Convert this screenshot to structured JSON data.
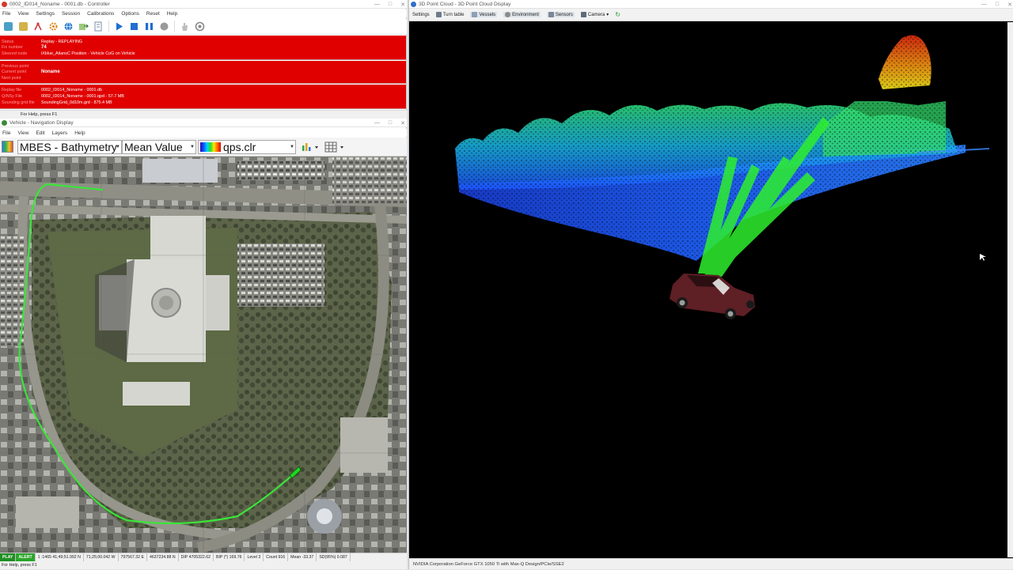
{
  "controller": {
    "title": "0002_ID014_Noname - 0001.db - Controller",
    "menu": [
      "File",
      "View",
      "Settings",
      "Session",
      "Calibrations",
      "Options",
      "Reset",
      "Help"
    ],
    "toolbar_icons": [
      "vehicle-icon",
      "database-icon",
      "calibration-icon",
      "settings-icon",
      "globe-icon",
      "export-icon",
      "document-icon",
      "play-icon",
      "stop-icon",
      "pause-icon",
      "record-icon",
      "hand-icon",
      "reset-icon"
    ],
    "panel1": {
      "rows": [
        {
          "key": "Status",
          "value": "Replay - REPLAYING"
        },
        {
          "key": "Fix number",
          "value": "74"
        },
        {
          "key": "Steered node",
          "value": "iXblue_AtlansC Position - Vehicle CoG on Vehicle"
        }
      ]
    },
    "panel2": {
      "rows": [
        {
          "key": "Previous point",
          "value": ""
        },
        {
          "key": "Current point",
          "value": "Noname"
        },
        {
          "key": "Next point",
          "value": ""
        }
      ]
    },
    "panel3": {
      "rows": [
        {
          "key": "Replay file",
          "value": "0002_ID014_Noname - 0001.db"
        },
        {
          "key": "QINSy File",
          "value": "0002_ID014_Noname - 0001.qpd   - 57.7 MB"
        },
        {
          "key": "Sounding grid file",
          "value": "SoundingGrid_0d10m.grd   - 875.4 MB"
        }
      ]
    },
    "status": "For Help, press F1"
  },
  "nav": {
    "title": "Vehicle - Navigation Display",
    "menu": [
      "File",
      "View",
      "Edit",
      "Layers",
      "Help"
    ],
    "layer_select": "MBES - Bathymetry",
    "value_select": "Mean Value",
    "color_file": "qps.clr",
    "status": {
      "play": "PLAY",
      "alert": "ALERT",
      "fields": [
        "1 :1465  41;49;51.992 N",
        "71;25;00.042 W",
        "797567.32 E",
        "4637234.88 N",
        "DIP 4705322.62",
        "BIP (*) 169.76",
        "Level 3",
        "Count 916",
        "Mean -33.37",
        "SD(95%) 0.087"
      ]
    },
    "help": "For Help, press F1"
  },
  "pointcloud": {
    "title": "3D Point Cloud - 3D Point Cloud Display",
    "toolbar": [
      {
        "label": "Settings",
        "icon": "settings-icon"
      },
      {
        "label": "Turn table",
        "icon": "turntable-icon"
      },
      {
        "label": "Vessels",
        "icon": "vessel-icon"
      },
      {
        "label": "Environment",
        "icon": "environment-icon"
      },
      {
        "label": "Sensors",
        "icon": "sensor-icon"
      },
      {
        "label": "Camera",
        "icon": "camera-icon"
      }
    ],
    "gpu": "NVIDIA Corporation GeForce GTX 1050 Ti with Max-Q Design/PCIe/SSE2"
  },
  "colors": {
    "alarm_red": "#e00000",
    "track_green": "#39e639",
    "cloud_blue": "#1f63ff",
    "cloud_cyan": "#19d2d8",
    "beam_green": "#2ef02e",
    "vehicle_maroon": "#5e1f25"
  }
}
